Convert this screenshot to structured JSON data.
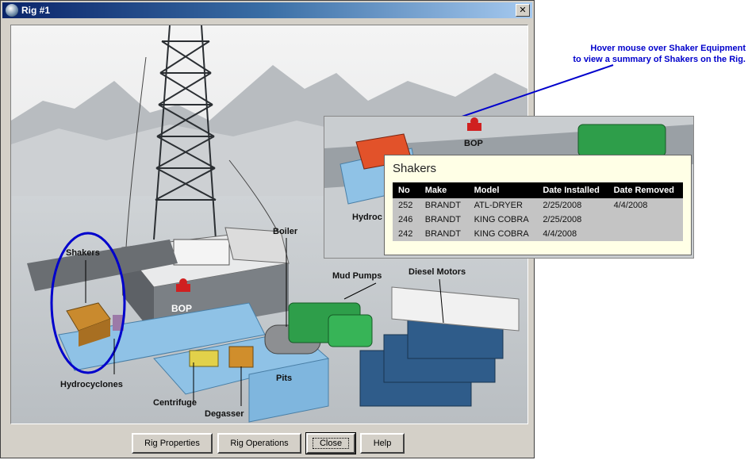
{
  "window": {
    "title": "Rig #1",
    "close_glyph": "✕"
  },
  "icons": [
    "app-icon",
    "close-icon",
    "bop-icon"
  ],
  "scene_labels": {
    "shakers": "Shakers",
    "boiler": "Boiler",
    "mud_pumps": "Mud Pumps",
    "diesel_motors": "Diesel Motors",
    "bop": "BOP",
    "hydrocyclones": "Hydrocyclones",
    "centrifuge": "Centrifuge",
    "pits": "Pits",
    "degasser": "Degasser"
  },
  "zoom_labels": {
    "bop": "BOP",
    "hydroc": "Hydroc"
  },
  "buttons": {
    "rig_properties": "Rig Properties",
    "rig_operations": "Rig Operations",
    "close": "Close",
    "help": "Help"
  },
  "callout": {
    "line1": "Hover mouse over Shaker Equipment",
    "line2": "to view a summary of Shakers on the Rig."
  },
  "tooltip": {
    "title": "Shakers",
    "columns": [
      "No",
      "Make",
      "Model",
      "Date Installed",
      "Date Removed"
    ],
    "rows": [
      [
        "252",
        "BRANDT",
        "ATL-DRYER",
        "2/25/2008",
        "4/4/2008"
      ],
      [
        "246",
        "BRANDT",
        "KING COBRA",
        "2/25/2008",
        ""
      ],
      [
        "242",
        "BRANDT",
        "KING COBRA",
        "4/4/2008",
        ""
      ]
    ]
  },
  "colors": {
    "annotation_blue": "#0000cc",
    "tooltip_bg": "#ffffe6",
    "equipment_green": "#2e9e4a",
    "pits_blue": "#7fb6de",
    "shaker_orange": "#c98a2e",
    "bop_red": "#d02020"
  }
}
